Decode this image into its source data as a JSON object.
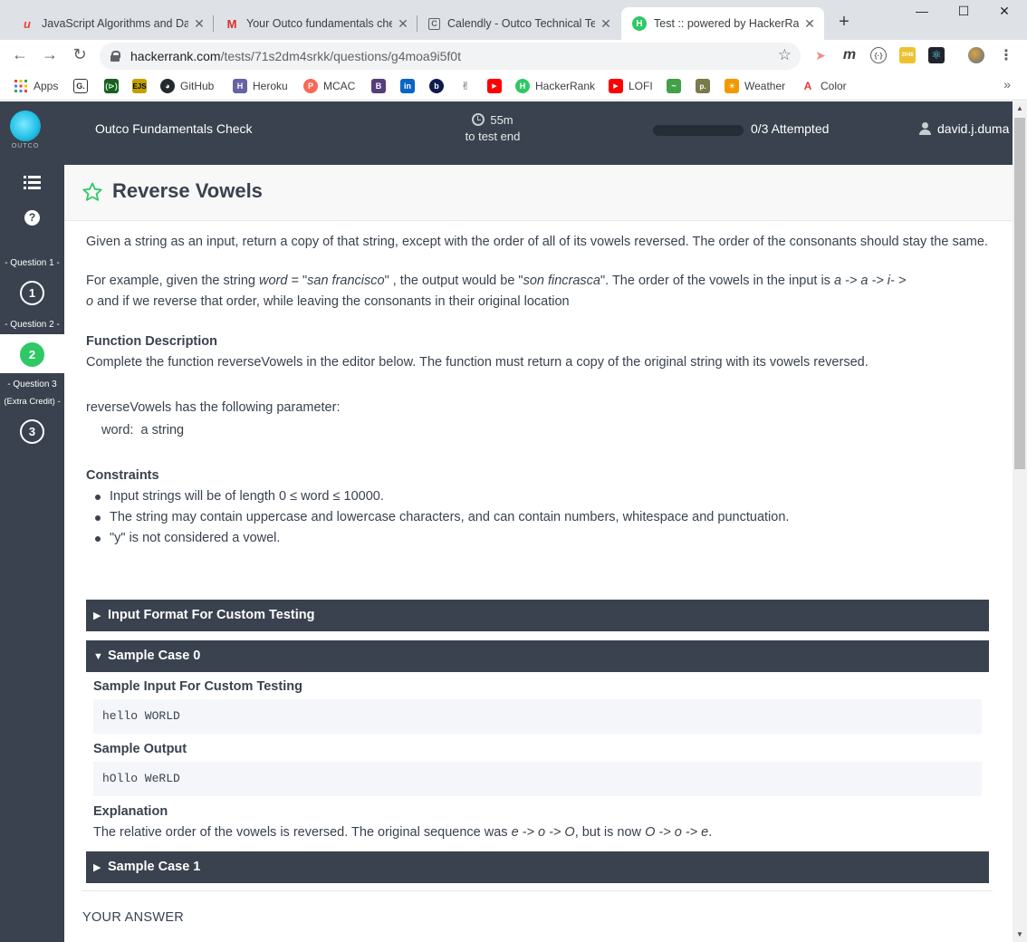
{
  "browser": {
    "tabs": [
      {
        "title": "JavaScript Algorithms and Data",
        "icon": "u",
        "color": "#e8453c",
        "active": false
      },
      {
        "title": "Your Outco fundamentals chec",
        "icon": "M",
        "color": "#d93025",
        "active": false
      },
      {
        "title": "Calendly - Outco Technical Tea",
        "icon": "C",
        "color": "#5f6368",
        "active": false
      },
      {
        "title": "Test :: powered by HackerRank",
        "icon": "H",
        "color": "#2ec866",
        "active": true
      }
    ],
    "url_host": "hackerrank.com",
    "url_path": "/tests/71s2dm4srkk/questions/g4moa9i5f0t",
    "bookmarks": [
      {
        "label": "Apps",
        "icon": "apps",
        "color": "#4285f4"
      },
      {
        "label": "",
        "icon": "G",
        "color": "#333333"
      },
      {
        "label": "",
        "icon": "⊳",
        "color": "#2e7d32"
      },
      {
        "label": "",
        "icon": "EJS",
        "color": "#c2a000"
      },
      {
        "label": "GitHub",
        "icon": "gh",
        "color": "#24292e"
      },
      {
        "label": "Heroku",
        "icon": "H",
        "color": "#6762a6"
      },
      {
        "label": "MCAC",
        "icon": "P",
        "color": "#f96854"
      },
      {
        "label": "",
        "icon": "B",
        "color": "#563d7c"
      },
      {
        "label": "",
        "icon": "in",
        "color": "#0a66c2"
      },
      {
        "label": "",
        "icon": "b",
        "color": "#0d1b4c"
      },
      {
        "label": "",
        "icon": "✌",
        "color": "#555555"
      },
      {
        "label": "",
        "icon": "▶",
        "color": "#ff0000"
      },
      {
        "label": "HackerRank",
        "icon": "H",
        "color": "#2ec866"
      },
      {
        "label": "LOFI",
        "icon": "▶",
        "color": "#ff0000"
      },
      {
        "label": "",
        "icon": "~",
        "color": "#43a047"
      },
      {
        "label": "",
        "icon": "p",
        "color": "#7a7a4a"
      },
      {
        "label": "Weather",
        "icon": "☀",
        "color": "#f29900"
      },
      {
        "label": "Color",
        "icon": "A",
        "color": "#e53935"
      }
    ]
  },
  "header": {
    "logo_text": "OUTCO",
    "test_title": "Outco Fundamentals Check",
    "timer_value": "55m",
    "timer_label": "to test end",
    "attempted": "0/3 Attempted",
    "progress": 0,
    "username": "david.j.duma"
  },
  "sidebar": {
    "questions": [
      {
        "label": "- Question 1 -",
        "number": "1",
        "current": false
      },
      {
        "label": "- Question 2 -",
        "number": "2",
        "current": true
      },
      {
        "label": "- Question 3",
        "label2": "(Extra Credit) -",
        "number": "3",
        "current": false
      }
    ]
  },
  "question": {
    "title": "Reverse Vowels",
    "intro": "Given a string as an input, return a copy of that string, except with the order of all of its vowels reversed. The order of the consonants should stay the same.",
    "example_a": "For example, given the string ",
    "example_word_var": "word",
    "example_eq": " = \"",
    "example_input": "san francisco",
    "example_b": "\" , the output would be \"",
    "example_output": "son fincrasca",
    "example_c": "\". The order of the vowels in the input is ",
    "vowel_order_1": "a -> a -> i- >",
    "vowel_order_2": "o",
    "example_d": " and if we reverse that order, while leaving the consonants in their original location",
    "fd_heading": "Function Description",
    "fd_text": "Complete the function reverseVowels in the editor below. The function must return a copy of the original string with its vowels reversed.",
    "param_intro": "reverseVowels has the following parameter:",
    "param_name": "word:",
    "param_desc": "  a string",
    "constraints_heading": "Constraints",
    "constraints": [
      "Input strings will be of length 0 ≤ word ≤ 10000.",
      "The string may contain uppercase and lowercase characters, and can contain numbers, whitespace and punctuation.",
      "\"y\" is not considered a vowel."
    ]
  },
  "sections": {
    "input_format": "Input Format For Custom Testing",
    "sample0": "Sample Case 0",
    "sample_input_heading": "Sample Input For Custom Testing",
    "sample_input": "hello WORLD",
    "sample_output_heading": "Sample Output",
    "sample_output": "hOllo WeRLD",
    "explanation_heading": "Explanation",
    "explanation_a": "The relative order of the vowels is reversed. The original sequence was ",
    "explanation_seq1": "e -> o -> O",
    "explanation_b": ", but is now ",
    "explanation_seq2": "O -> o -> e",
    "explanation_c": ".",
    "sample1": "Sample Case 1",
    "your_answer": "YOUR ANSWER"
  },
  "colors": {
    "header_bg": "#39424e",
    "accent_green": "#2ec866",
    "code_bg": "#f4f6f9"
  }
}
